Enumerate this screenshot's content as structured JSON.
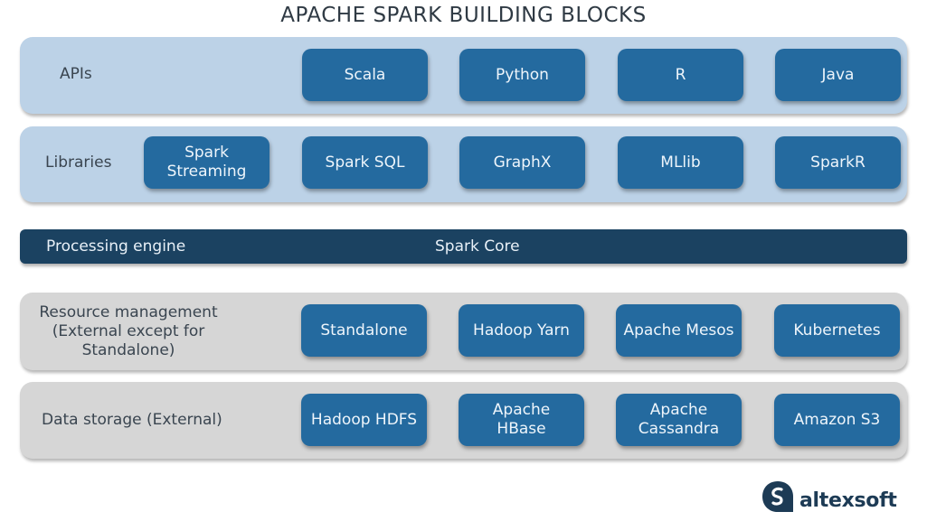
{
  "title": "APACHE SPARK BUILDING BLOCKS",
  "colors": {
    "block_fill": "#246a9f",
    "block_text": "#eef5fb",
    "upper_row_bg": "#bcd2e7",
    "lower_row_bg": "#d6d6d6",
    "engine_bg": "#1b4261",
    "title_text": "#2f3a44",
    "logo": "#1d3b55"
  },
  "layers": {
    "apis": {
      "label": "APIs",
      "items": [
        "Scala",
        "Python",
        "R",
        "Java"
      ]
    },
    "libraries": {
      "label": "Libraries",
      "items": [
        "Spark Streaming",
        "Spark SQL",
        "GraphX",
        "MLlib",
        "SparkR"
      ]
    },
    "processing_engine": {
      "label": "Processing engine",
      "core": "Spark Core"
    },
    "resource_management": {
      "label": "Resource management (External except for Standalone)",
      "items": [
        "Standalone",
        "Hadoop Yarn",
        "Apache Mesos",
        "Kubernetes"
      ]
    },
    "data_storage": {
      "label": "Data storage (External)",
      "items": [
        "Hadoop HDFS",
        "Apache HBase",
        "Apache Cassandra",
        "Amazon S3"
      ]
    }
  },
  "logo": {
    "icon": "altexsoft-logo-icon",
    "text": "altexsoft"
  }
}
